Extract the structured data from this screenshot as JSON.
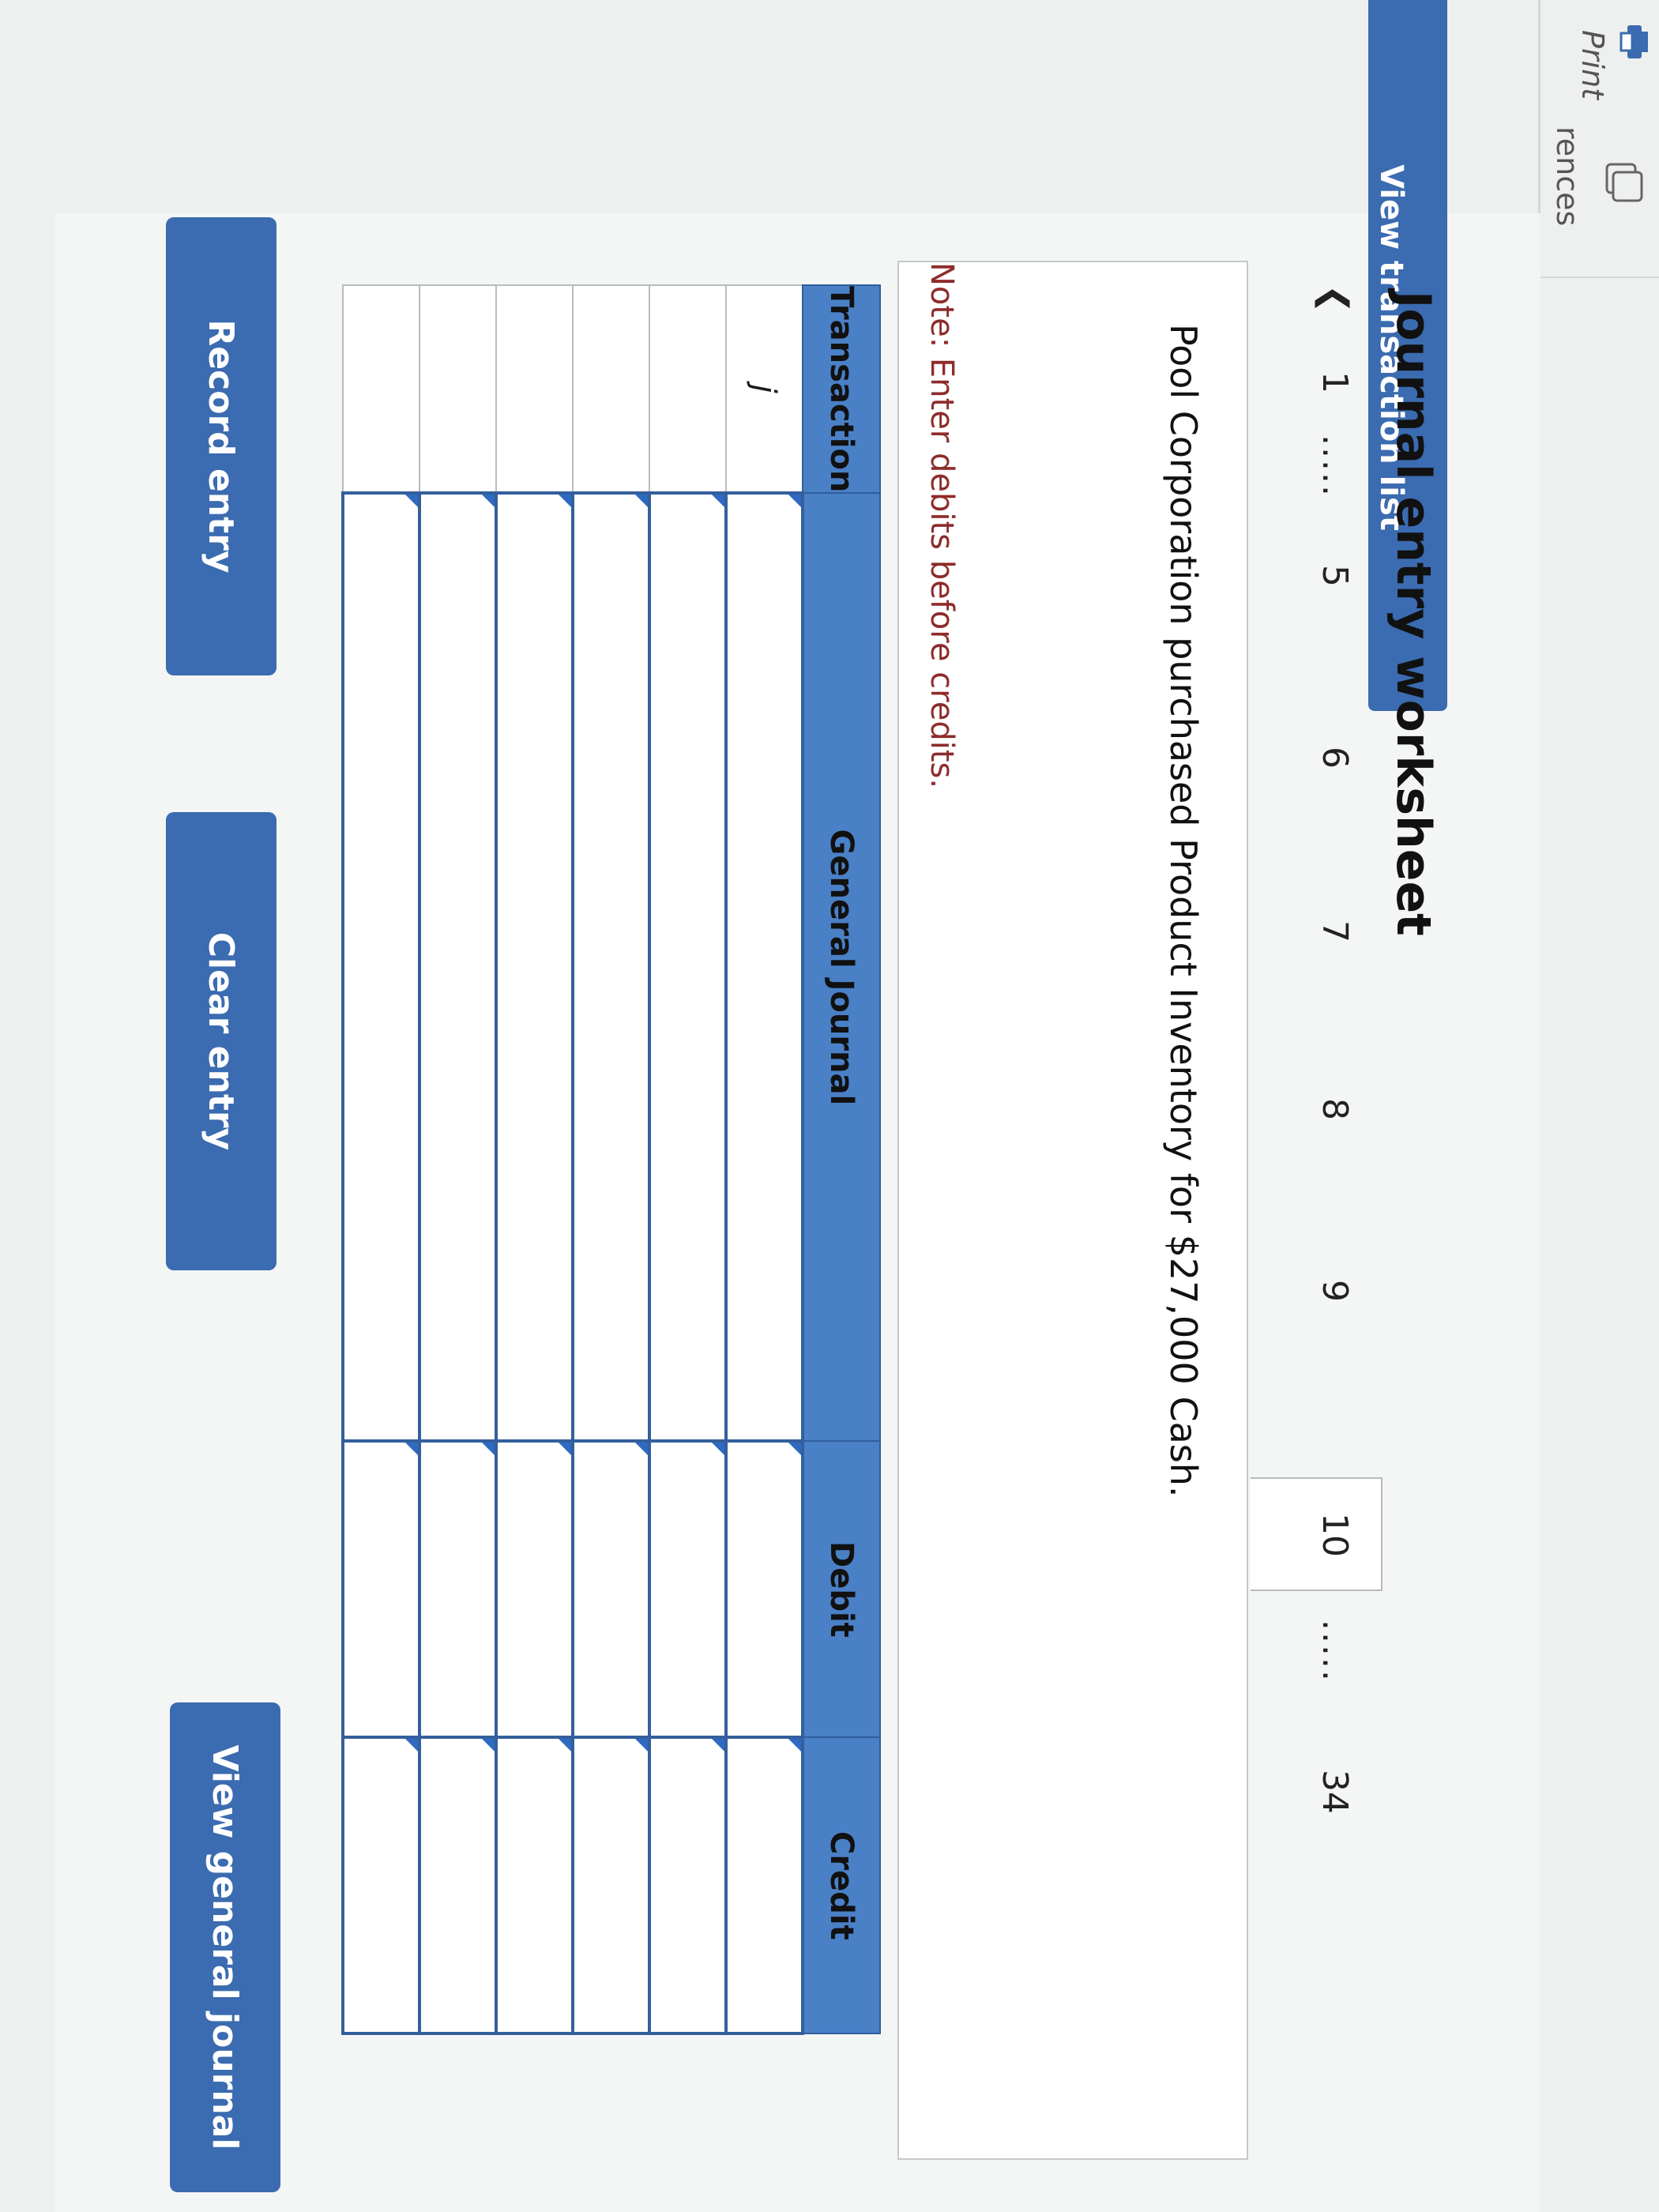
{
  "toolbar": {
    "print_label": "Print",
    "references_label": "rences"
  },
  "view_transaction_list_label": "View transaction list",
  "worksheet": {
    "title": "Journal entry worksheet",
    "pagination": {
      "pages": [
        "1",
        "5",
        "6",
        "7",
        "8",
        "9",
        "10",
        "34"
      ],
      "active": "10",
      "ellipsis": "....."
    },
    "transaction_description": "Pool Corporation purchased Product Inventory for $27,000 Cash.",
    "note": "Note: Enter debits before credits."
  },
  "journal_table": {
    "headers": [
      "Transaction",
      "General Journal",
      "Debit",
      "Credit"
    ],
    "transaction_id": "j",
    "row_count": 6
  },
  "buttons": {
    "record_entry": "Record entry",
    "clear_entry": "Clear entry",
    "view_general_journal": "View general journal"
  },
  "colors": {
    "accent": "#3b6bb0",
    "header": "#4a80c6",
    "note": "#8e2b2b"
  }
}
